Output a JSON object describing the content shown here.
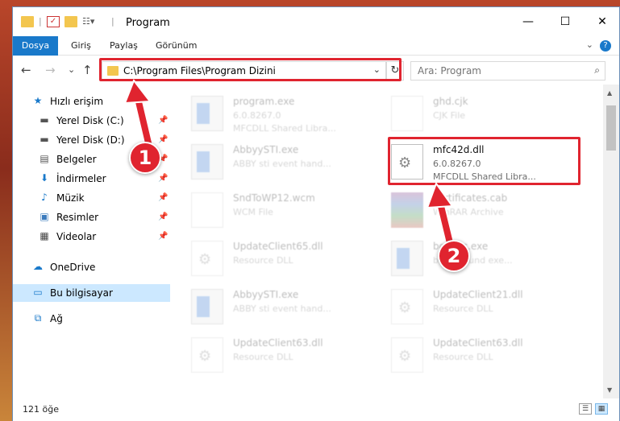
{
  "window": {
    "title": "Program"
  },
  "ribbon": {
    "tabs": [
      "Dosya",
      "Giriş",
      "Paylaş",
      "Görünüm"
    ],
    "help": "?"
  },
  "nav": {
    "back": "←",
    "forward": "→",
    "recent": "⌄",
    "up": "↑",
    "address_path": "C:\\Program Files\\Program Dizini",
    "refresh": "↻",
    "search_placeholder": "Ara: Program"
  },
  "sidebar": {
    "items": [
      {
        "label": "Hızlı erişim",
        "icon": "star-icon",
        "pinned": false
      },
      {
        "label": "Yerel Disk (C:)",
        "icon": "drive-icon",
        "pinned": true
      },
      {
        "label": "Yerel Disk (D:)",
        "icon": "drive-icon",
        "pinned": true
      },
      {
        "label": "Belgeler",
        "icon": "documents-icon",
        "pinned": true
      },
      {
        "label": "İndirmeler",
        "icon": "download-icon",
        "pinned": true
      },
      {
        "label": "Müzik",
        "icon": "music-icon",
        "pinned": true
      },
      {
        "label": "Resimler",
        "icon": "pictures-icon",
        "pinned": true
      },
      {
        "label": "Videolar",
        "icon": "videos-icon",
        "pinned": true
      },
      {
        "label": "OneDrive",
        "icon": "cloud-icon",
        "pinned": false
      },
      {
        "label": "Bu bilgisayar",
        "icon": "computer-icon",
        "pinned": false,
        "selected": true
      },
      {
        "label": "Ağ",
        "icon": "network-icon",
        "pinned": false
      }
    ]
  },
  "files": [
    {
      "name": "program.exe",
      "meta1": "6.0.8267.0",
      "meta2": "MFCDLL Shared Libra...",
      "kind": "app",
      "faded": true
    },
    {
      "name": "ghd.cjk",
      "meta1": "CJK File",
      "meta2": "",
      "kind": "doc",
      "faded": true
    },
    {
      "name": "AbbyySTI.exe",
      "meta1": "ABBY sti event hand...",
      "meta2": "",
      "kind": "app",
      "faded": true
    },
    {
      "name": "mfc42d.dll",
      "meta1": "6.0.8267.0",
      "meta2": "MFCDLL Shared Libra...",
      "kind": "dll",
      "faded": false
    },
    {
      "name": "SndToWP12.wcm",
      "meta1": "WCM File",
      "meta2": "",
      "kind": "doc",
      "faded": true
    },
    {
      "name": "certificates.cab",
      "meta1": "WinRAR Archive",
      "meta2": "",
      "kind": "rar",
      "faded": true
    },
    {
      "name": "UpdateClient65.dll",
      "meta1": "Resource DLL",
      "meta2": "",
      "kind": "dll",
      "faded": true
    },
    {
      "name": "bgexec.exe",
      "meta1": "background exe...",
      "meta2": "",
      "kind": "app",
      "faded": true
    },
    {
      "name": "AbbyySTI.exe",
      "meta1": "ABBY sti event hand...",
      "meta2": "",
      "kind": "app",
      "faded": true
    },
    {
      "name": "UpdateClient21.dll",
      "meta1": "Resource DLL",
      "meta2": "",
      "kind": "dll",
      "faded": true
    },
    {
      "name": "UpdateClient63.dll",
      "meta1": "Resource DLL",
      "meta2": "",
      "kind": "dll",
      "faded": true
    },
    {
      "name": "UpdateClient63.dll",
      "meta1": "Resource DLL",
      "meta2": "",
      "kind": "dll",
      "faded": true
    }
  ],
  "status": {
    "count": "121 öğe"
  },
  "annotations": {
    "badge1": "1",
    "badge2": "2"
  },
  "colors": {
    "accent": "#1979ca",
    "highlight": "#e0242f",
    "selected": "#cce8ff"
  }
}
